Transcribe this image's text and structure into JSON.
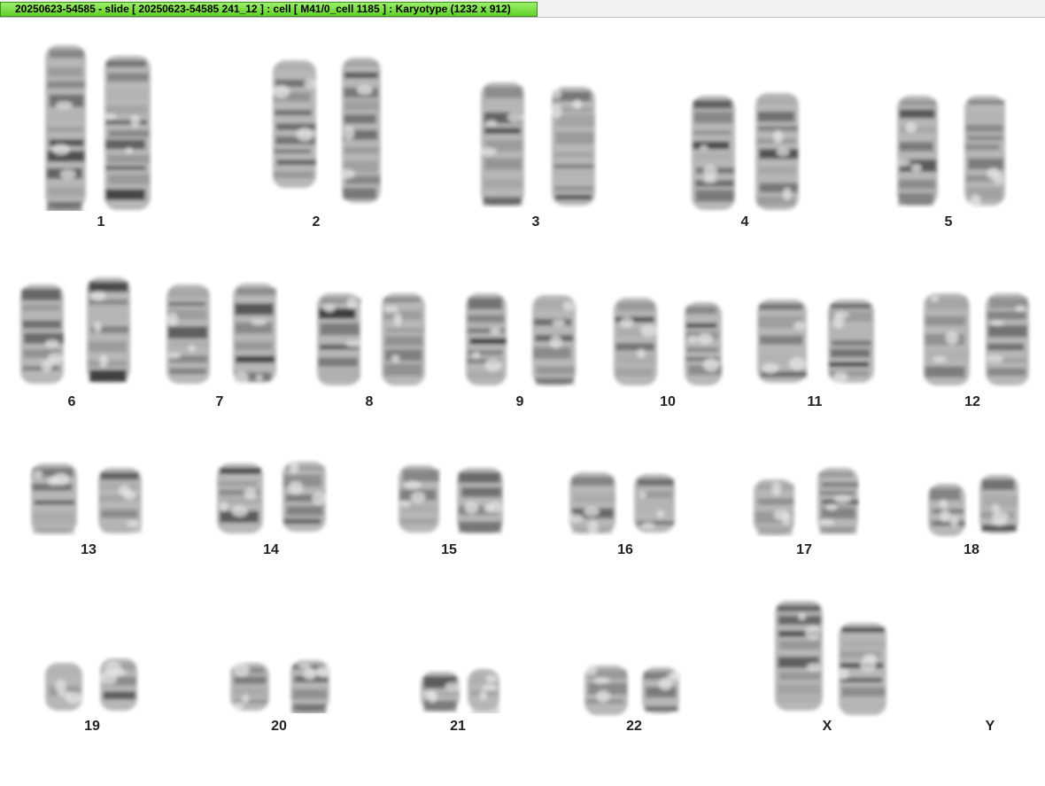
{
  "window": {
    "title": "20250623-54585 - slide [ 20250623-54585 241_12 ] : cell [ M41/0_cell 1185 ] : Karyotype  (1232 x 912)"
  },
  "karyotype": {
    "labels": [
      "1",
      "2",
      "3",
      "4",
      "5",
      "6",
      "7",
      "8",
      "9",
      "10",
      "11",
      "12",
      "13",
      "14",
      "15",
      "16",
      "17",
      "18",
      "19",
      "20",
      "21",
      "22",
      "X",
      "Y"
    ]
  }
}
